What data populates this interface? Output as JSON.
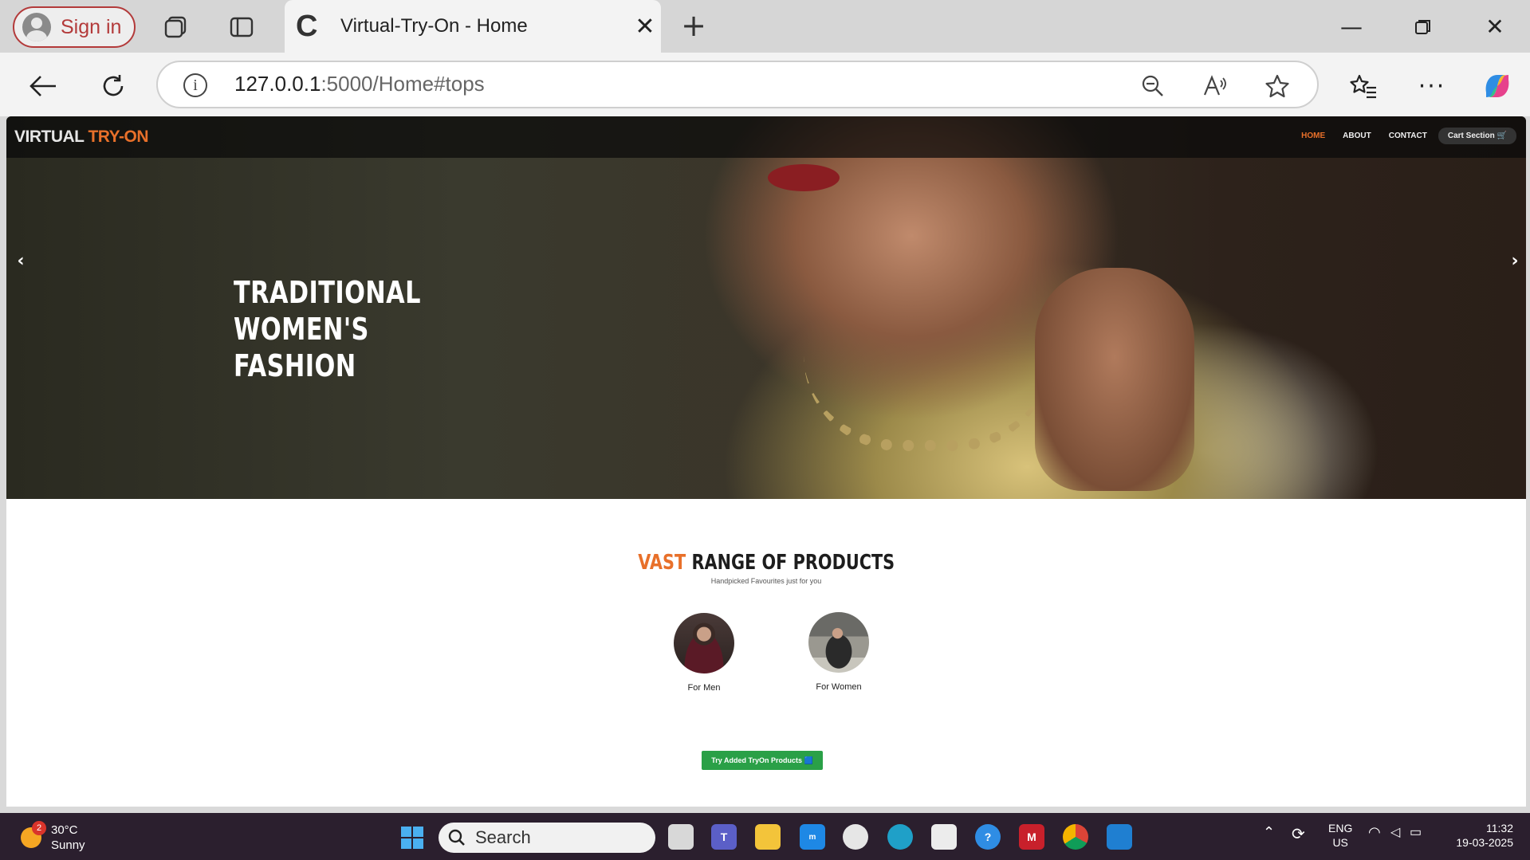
{
  "browser": {
    "signin_label": "Sign in",
    "tab_title": "Virtual-Try-On - Home",
    "url_host": "127.0.0.1",
    "url_rest": ":5000/Home#tops"
  },
  "site": {
    "brand_main": "VIRTUAL",
    "brand_accent": "TRY-ON",
    "nav": [
      "HOME",
      "ABOUT",
      "CONTACT"
    ],
    "cart_label": "Cart Section 🛒",
    "hero_title": "TRADITIONAL WOMEN'S FASHION",
    "section_title_accent": "VAST",
    "section_title_rest": "RANGE OF PRODUCTS",
    "section_subtitle": "Handpicked Favourites just for you",
    "categories": [
      {
        "label": "For Men"
      },
      {
        "label": "For Women"
      }
    ],
    "try_button": "Try Added TryOn Products 🟦"
  },
  "taskbar": {
    "temperature": "30°C",
    "condition": "Sunny",
    "weather_badge": "2",
    "search_placeholder": "Search",
    "lang_top": "ENG",
    "lang_bottom": "US",
    "time": "11:32",
    "date": "19-03-2025"
  },
  "colors": {
    "accent": "#e8702a",
    "try_button": "#2aa047",
    "signin_border": "#b33a3a"
  }
}
